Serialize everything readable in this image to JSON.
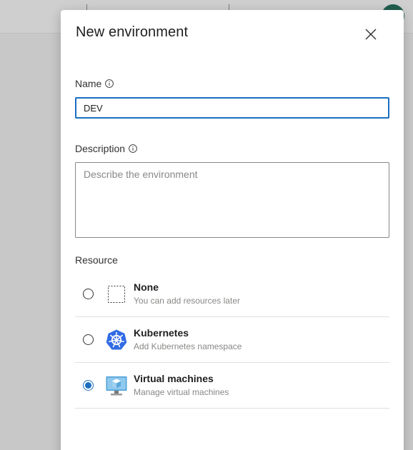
{
  "dialog": {
    "title": "New environment"
  },
  "fields": {
    "name": {
      "label": "Name",
      "value": "DEV"
    },
    "description": {
      "label": "Description",
      "placeholder": "Describe the environment",
      "value": ""
    }
  },
  "resource": {
    "label": "Resource",
    "selected": "virtual-machines",
    "options": [
      {
        "id": "none",
        "title": "None",
        "subtitle": "You can add resources later",
        "icon": "dashed-square-icon"
      },
      {
        "id": "kubernetes",
        "title": "Kubernetes",
        "subtitle": "Add Kubernetes namespace",
        "icon": "kubernetes-icon"
      },
      {
        "id": "virtual-machines",
        "title": "Virtual machines",
        "subtitle": "Manage virtual machines",
        "icon": "virtual-machine-icon"
      }
    ]
  },
  "colors": {
    "accent": "#1b6ec2",
    "kubernetes": "#326ce5",
    "avatar": "#1f5e4c"
  }
}
